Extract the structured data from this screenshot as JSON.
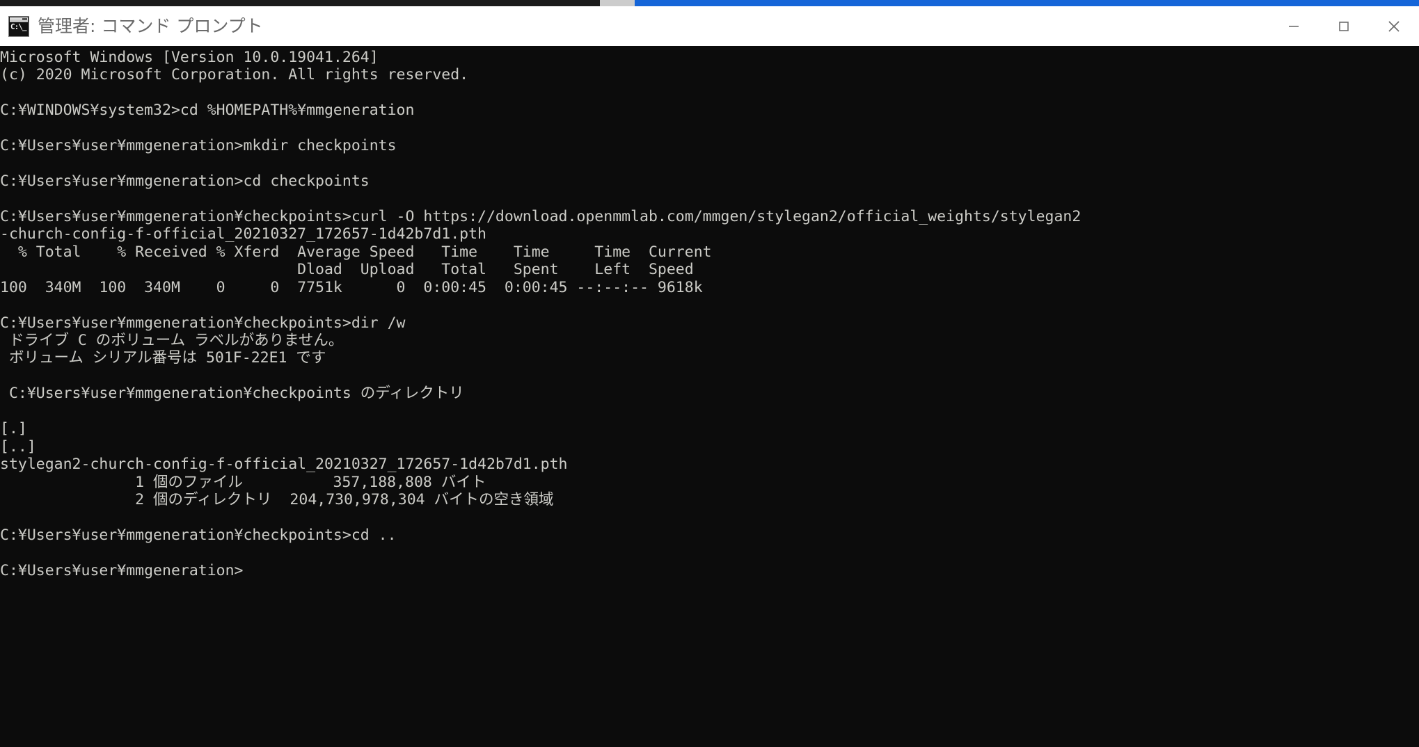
{
  "window": {
    "title": "管理者: コマンド プロンプト",
    "icon_name": "command-prompt-icon",
    "icon_glyph": "C:\\_",
    "background_color": "#0c0c0c",
    "text_color": "#ccccc7",
    "titlebar_color": "#ffffff",
    "accent_color": "#1565d8",
    "controls": {
      "minimize_label": "最小化",
      "maximize_label": "最大化",
      "close_label": "閉じる"
    }
  },
  "console": {
    "lines": [
      "Microsoft Windows [Version 10.0.19041.264]",
      "(c) 2020 Microsoft Corporation. All rights reserved.",
      "",
      "C:\\WINDOWS\\system32>cd %HOMEPATH%\\mmgeneration",
      "",
      "C:\\Users\\user\\mmgeneration>mkdir checkpoints",
      "",
      "C:\\Users\\user\\mmgeneration>cd checkpoints",
      "",
      "C:\\Users\\user\\mmgeneration\\checkpoints>curl -O https://download.openmmlab.com/mmgen/stylegan2/official_weights/stylegan2",
      "-church-config-f-official_20210327_172657-1d42b7d1.pth",
      "  % Total    % Received % Xferd  Average Speed   Time    Time     Time  Current",
      "                                 Dload  Upload   Total   Spent    Left  Speed",
      "100  340M  100  340M    0     0  7751k      0  0:00:45  0:00:45 --:--:-- 9618k",
      "",
      "C:\\Users\\user\\mmgeneration\\checkpoints>dir /w",
      " ドライブ C のボリューム ラベルがありません。",
      " ボリューム シリアル番号は 501F-22E1 です",
      "",
      " C:\\Users\\user\\mmgeneration\\checkpoints のディレクトリ",
      "",
      "[.]",
      "[..]",
      "stylegan2-church-config-f-official_20210327_172657-1d42b7d1.pth",
      "               1 個のファイル          357,188,808 バイト",
      "               2 個のディレクトリ  204,730,978,304 バイトの空き領域",
      "",
      "C:\\Users\\user\\mmgeneration\\checkpoints>cd ..",
      "",
      "C:\\Users\\user\\mmgeneration>"
    ]
  }
}
